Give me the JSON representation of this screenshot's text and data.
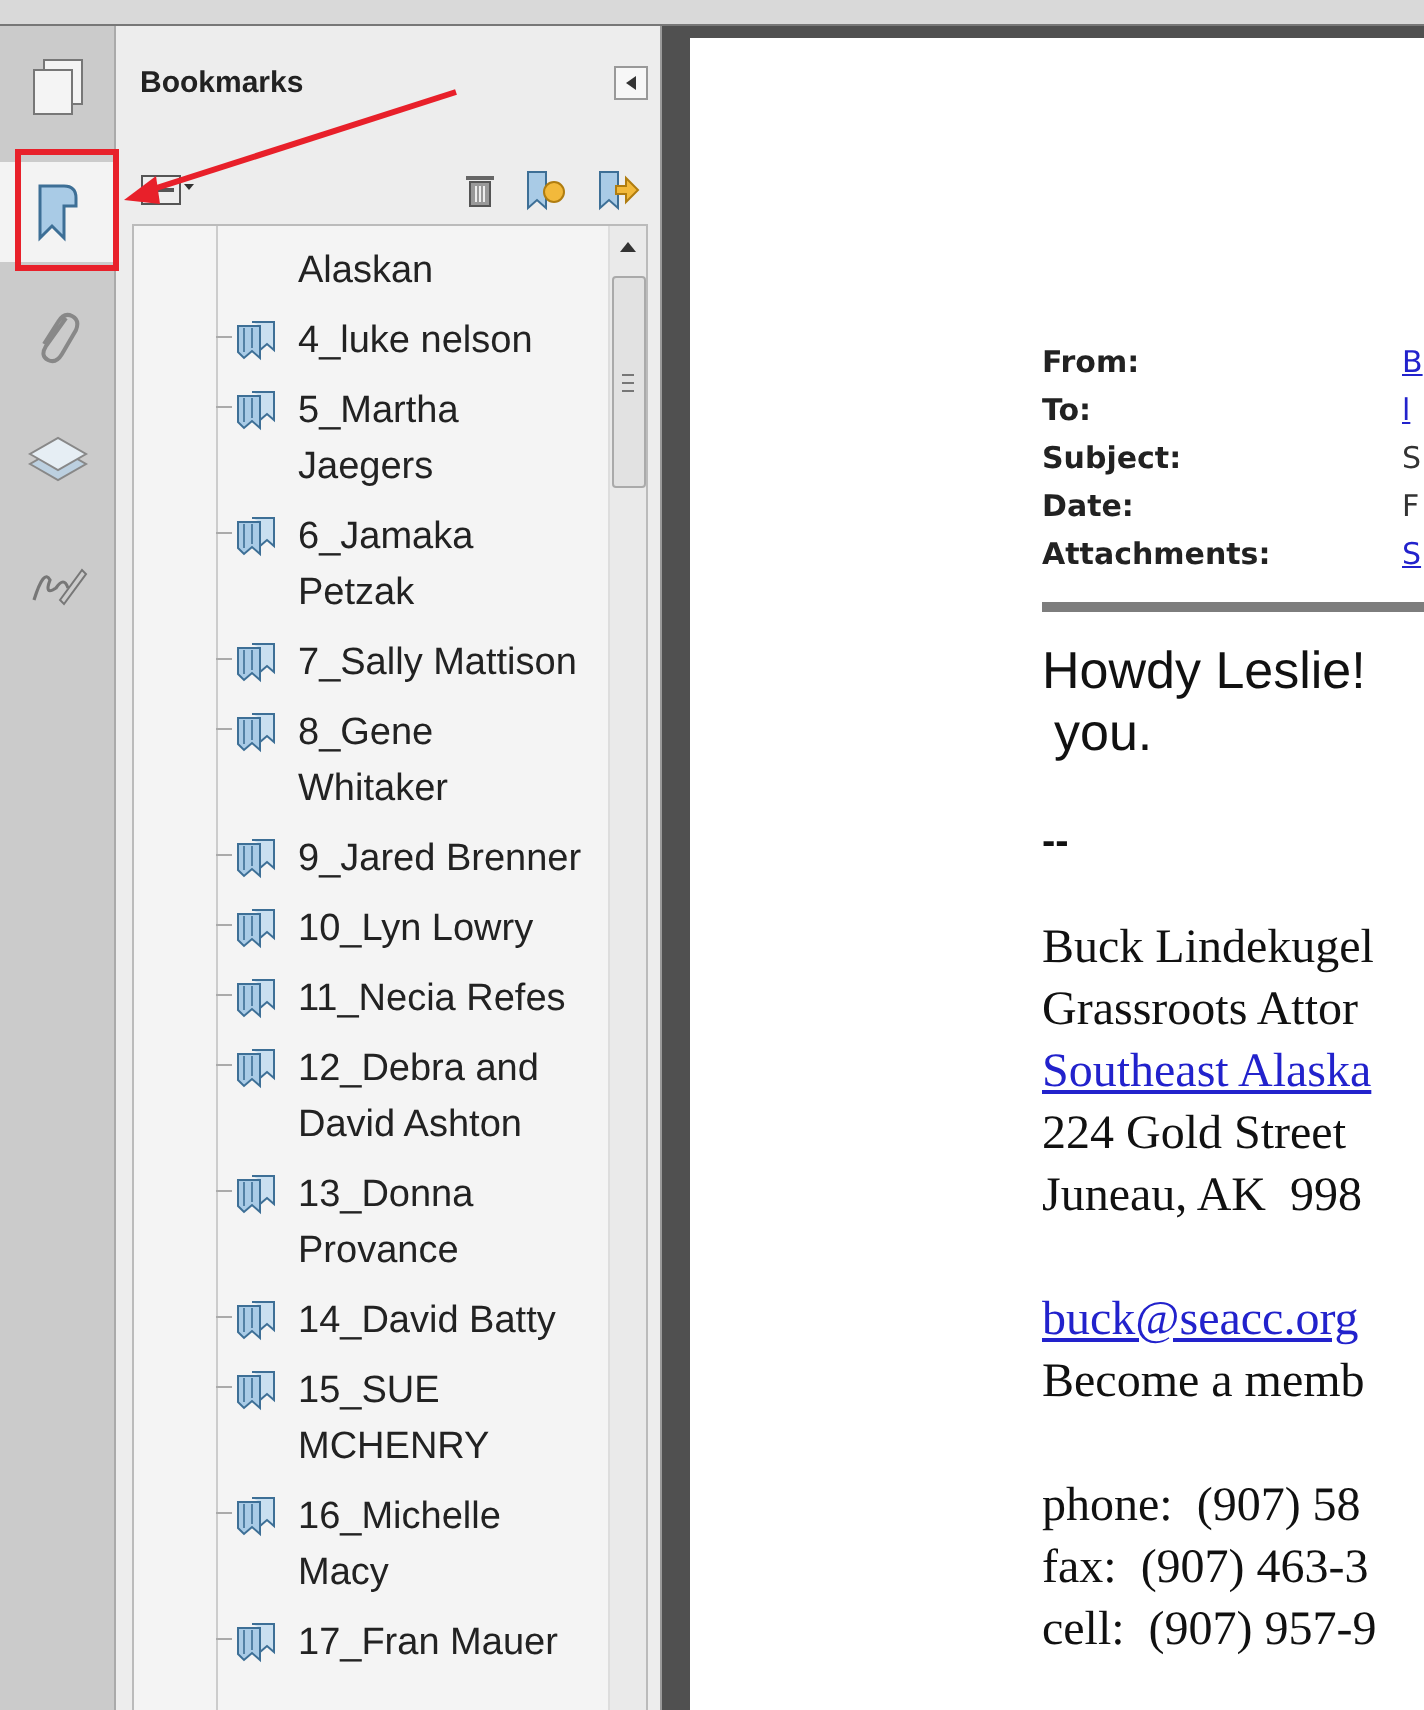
{
  "nav_tools": [
    {
      "kind": "pages",
      "selected": false
    },
    {
      "kind": "bookmarks",
      "selected": true
    },
    {
      "kind": "attachments",
      "selected": false
    },
    {
      "kind": "layers",
      "selected": false
    },
    {
      "kind": "signatures",
      "selected": false
    }
  ],
  "panel": {
    "title": "Bookmarks"
  },
  "bookmarks": [
    {
      "label": "Alaskan",
      "kind": "continuation"
    },
    {
      "label": "4_luke nelson",
      "kind": "bookmark"
    },
    {
      "label": "5_Martha Jaegers",
      "kind": "bookmark"
    },
    {
      "label": "6_Jamaka Petzak",
      "kind": "bookmark"
    },
    {
      "label": "7_Sally Mattison",
      "kind": "bookmark"
    },
    {
      "label": "8_Gene Whitaker",
      "kind": "bookmark"
    },
    {
      "label": "9_Jared Brenner",
      "kind": "bookmark"
    },
    {
      "label": "10_Lyn Lowry",
      "kind": "bookmark"
    },
    {
      "label": "11_Necia Refes",
      "kind": "bookmark"
    },
    {
      "label": "12_Debra and David Ashton",
      "kind": "bookmark"
    },
    {
      "label": "13_Donna Provance",
      "kind": "bookmark"
    },
    {
      "label": "14_David Batty",
      "kind": "bookmark"
    },
    {
      "label": "15_SUE MCHENRY",
      "kind": "bookmark"
    },
    {
      "label": "16_Michelle Macy",
      "kind": "bookmark"
    },
    {
      "label": "17_Fran Mauer",
      "kind": "bookmark"
    }
  ],
  "email_header": [
    {
      "label": "From:",
      "value": "B",
      "link": true
    },
    {
      "label": "To:",
      "value": "l",
      "link": true
    },
    {
      "label": "Subject:",
      "value": "S",
      "link": false
    },
    {
      "label": "Date:",
      "value": "F",
      "link": false
    },
    {
      "label": "Attachments:",
      "value": "S",
      "link": true
    }
  ],
  "greeting": [
    "Howdy Leslie!",
    "you."
  ],
  "separator": "--",
  "signature": [
    {
      "text": "Buck Lindekugel",
      "link": false
    },
    {
      "text": "Grassroots Attor",
      "link": false
    },
    {
      "text": "Southeast Alaska",
      "link": true
    },
    {
      "text": "224 Gold Street",
      "link": false
    },
    {
      "text": "Juneau, AK  998",
      "link": false
    },
    {
      "text": "buck@seacc.org",
      "link": true,
      "space_before": true
    },
    {
      "text": "Become a memb",
      "link": false
    },
    {
      "text": "phone:  (907) 58",
      "link": false,
      "space_before": true
    },
    {
      "text": "fax:  (907) 463-3",
      "link": false
    },
    {
      "text": "cell:  (907) 957-9",
      "link": false
    }
  ]
}
